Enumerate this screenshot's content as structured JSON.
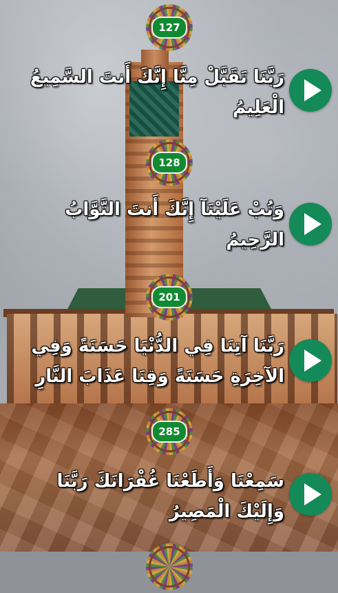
{
  "verses": [
    {
      "number": "127",
      "text": "رَبَّنَا تَقَبَّلْ مِنَّا إِنَّكَ أَنتَ السَّمِيعُ الْعَلِيمُ",
      "play_icon": "play-icon"
    },
    {
      "number": "128",
      "text": "وَتُبْ عَلَيْنَآ إِنَّكَ أَنتَ التَّوَّابُ الرَّحِيمُ",
      "play_icon": "play-icon"
    },
    {
      "number": "201",
      "text": "رَبَّنَا آتِنَا فِي الدُّنْيَا حَسَنَةً وَفِي الآخِرَةِ حَسَنَةً وَقِنَا عَذَابَ النَّارِ",
      "play_icon": "play-icon"
    },
    {
      "number": "285",
      "text": "سَمِعْنَا وَأَطَعْنَا غُفْرَانَكَ رَبَّنَا وَإِلَيْكَ الْمَصِيرُ",
      "play_icon": "play-icon"
    }
  ],
  "colors": {
    "badge_green": "#128a32",
    "play_green": "#138a57",
    "text": "#ffffff"
  }
}
